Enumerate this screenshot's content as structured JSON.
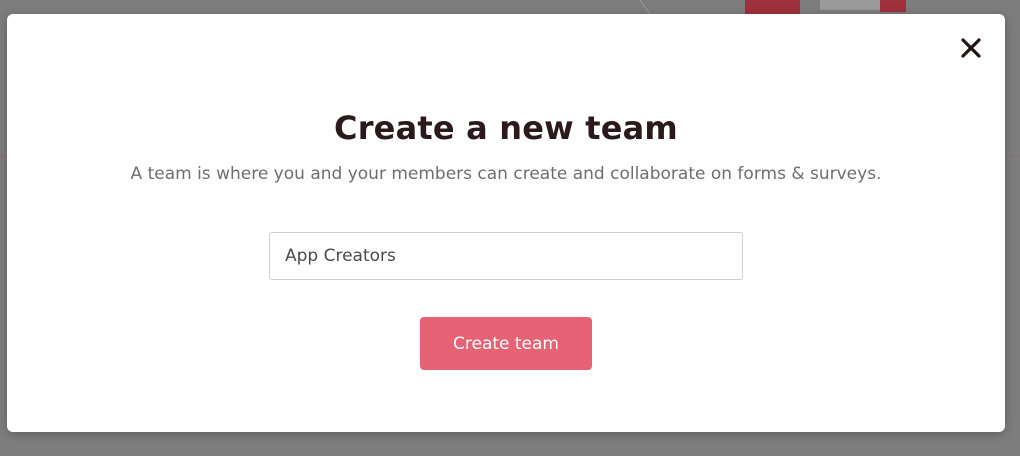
{
  "modal": {
    "title": "Create a new team",
    "subtitle": "A team is where you and your members can create and collaborate on forms & surveys.",
    "team_name_input": {
      "value": "App Creators",
      "placeholder": ""
    },
    "create_button_label": "Create team",
    "close_icon": "close-icon"
  },
  "colors": {
    "accent": "#e66275",
    "title": "#2a1a1c",
    "subtitle": "#6e6e6e",
    "backdrop": "#7d7d7d"
  }
}
